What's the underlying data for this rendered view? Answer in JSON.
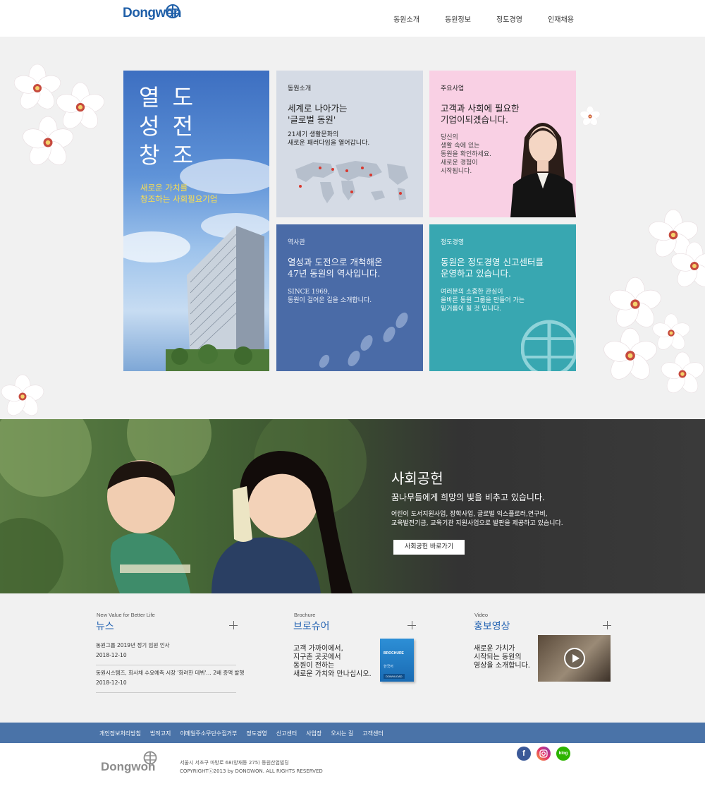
{
  "brand": {
    "name": "Dongwon"
  },
  "nav": {
    "items": [
      "동원소개",
      "동원정보",
      "정도경영",
      "인재채용"
    ]
  },
  "hero": {
    "main": {
      "title_lines": [
        "열 도",
        "성 전",
        "창 조"
      ],
      "sub_lines": [
        "새로운 가치를",
        "창조하는 사회필요기업"
      ]
    },
    "intro": {
      "label": "동원소개",
      "head_lines": [
        "세계로 나아가는",
        "'글로벌 동원'"
      ],
      "body_lines": [
        "21세기 생활문화의",
        "새로운 패러다임을 열어갑니다."
      ]
    },
    "business": {
      "label": "주요사업",
      "head_lines": [
        "고객과 사회에 필요한",
        "기업이되겠습니다."
      ],
      "body_lines": [
        "당신의",
        "생활 속에 있는",
        "동원을 확인하세요.",
        "새로운 경험이",
        "시작됩니다."
      ]
    },
    "history": {
      "label": "역사관",
      "head_lines": [
        "열성과 도전으로 개척해온",
        "47년 동원의 역사입니다."
      ],
      "body_lines": [
        "SINCE 1969,",
        "동원이 걸어온 길을 소개합니다."
      ]
    },
    "ethics": {
      "label": "정도경영",
      "head_lines": [
        "동원은 정도경영 신고센터를",
        "운영하고 있습니다."
      ],
      "body_lines": [
        "여러분의 소중한 관심이",
        "올바른 동원 그룹을 만들어 가는",
        "밑거름이 될 것 입니다."
      ]
    }
  },
  "social": {
    "title": "사회공헌",
    "subtitle": "꿈나무들에게 희망의 빛을 비추고 있습니다.",
    "desc_lines": [
      "어린이 도서지원사업, 장학사업, 글로벌 익스플로러,연구비,",
      "교육발전기금, 교육기관 지원사업으로 발판을 제공하고 있습니다."
    ],
    "button": "사회공헌 바로가기"
  },
  "news": {
    "eyebrow": "New Value for Better Life",
    "title": "뉴스",
    "items": [
      {
        "title": "동원그룹 2019년 정기 임원 인사",
        "date": "2018-12-10"
      },
      {
        "title": "동원시스템즈, 회사채 수요예측 시장 '화려한 데뷔'… 2배 증액 발행",
        "date": "2018-12-10"
      }
    ]
  },
  "brochure": {
    "eyebrow": "Brochure",
    "title": "브로슈어",
    "text_lines": [
      "고객 가까이에서,",
      "지구촌 곳곳에서",
      "동원이 전하는",
      "새로운 가치와 만나십시오."
    ],
    "cover_title": "BROCHURE",
    "cover_sub": "한국어",
    "cover_btn": "DOWNLOAD"
  },
  "video": {
    "eyebrow": "Video",
    "title": "홍보영상",
    "text_lines": [
      "새로운 가치가",
      "시작되는 동원의",
      "영상을 소개합니다."
    ]
  },
  "footer": {
    "links": [
      "개인정보처리방침",
      "법적고지",
      "이메일주소무단수집거부",
      "정도경영",
      "신고센터",
      "사업장",
      "오시는 길",
      "고객센터"
    ],
    "logo": "Dongwon",
    "address": "서울시 서초구 마방로 68(양재동 275) 동원산업빌딩",
    "copyright": "COPYRIGHTⓒ2013 by DONGWON. ALL RIGHTS RESERVED",
    "sns": {
      "facebook": "f",
      "blog": "blog"
    }
  },
  "colors": {
    "brand_blue": "#1f5fa8",
    "intro_tile": "#d5dbe5",
    "business_tile": "#f9d0e4",
    "history_tile": "#4a6ba7",
    "ethics_tile": "#38a7b1",
    "footer_bar": "#4a73a8"
  }
}
